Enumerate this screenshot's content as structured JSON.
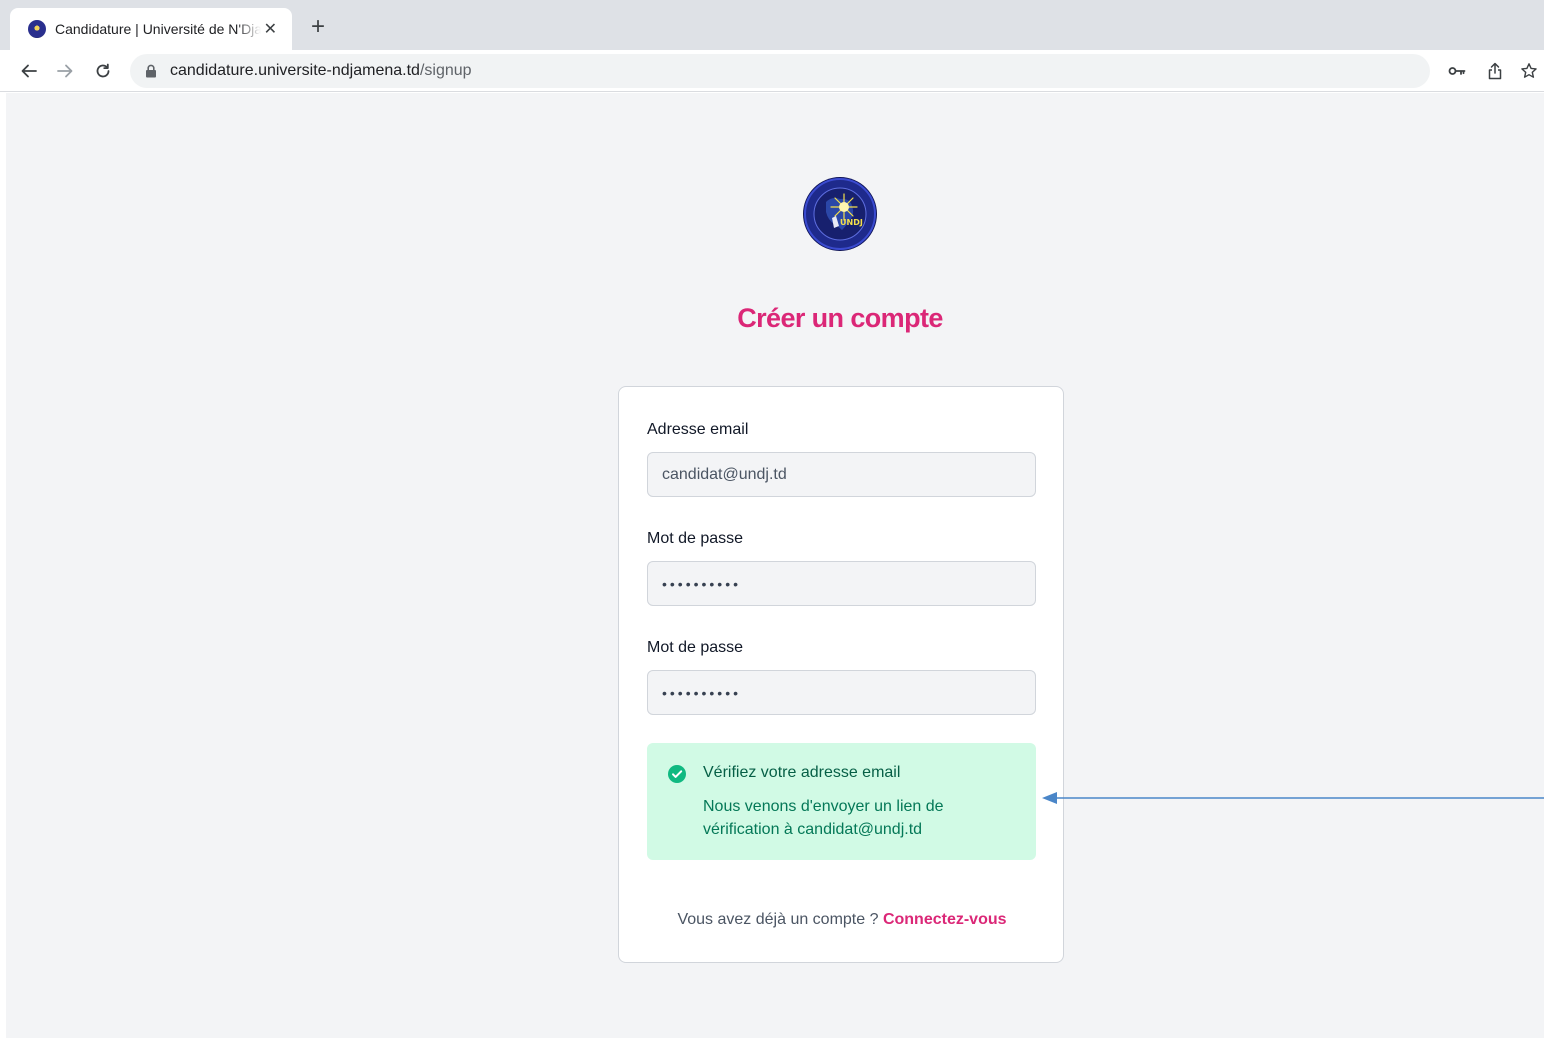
{
  "browser": {
    "tab_title": "Candidature | Université de N'Djamena",
    "tab_close_glyph": "✕",
    "new_tab_glyph": "+",
    "url_host": "candidature.universite-ndjamena.td",
    "url_path": "/signup"
  },
  "page": {
    "title": "Créer un compte",
    "logo_text": "UNDJ",
    "email_label": "Adresse email",
    "email_value": "candidat@undj.td",
    "password_label": "Mot de passe",
    "password_mask": "••••••••••",
    "confirm_label": "Mot de passe",
    "confirm_mask": "••••••••••",
    "alert": {
      "title": "Vérifiez votre adresse email",
      "body": "Nous venons d'envoyer un lien de vérification à candidat@undj.td"
    },
    "signin_prompt": "Vous avez déjà un compte ? ",
    "signin_link": "Connectez-vous"
  },
  "colors": {
    "brand_pink": "#db2777",
    "success_bg": "#d1fae5",
    "success_text": "#065f46",
    "success_icon": "#10b981",
    "annotation_arrow": "#4a86c8"
  }
}
